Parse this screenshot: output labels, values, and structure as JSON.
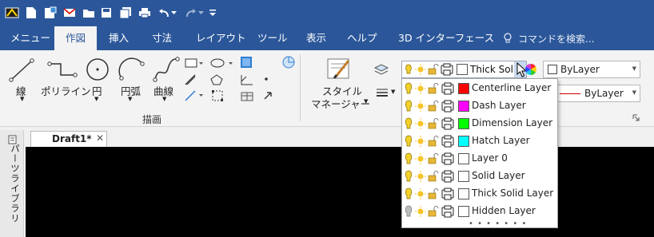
{
  "menu": {
    "items": [
      "メニュー",
      "作図",
      "挿入",
      "寸法",
      "レイアウト",
      "ツール",
      "表示",
      "ヘルプ",
      "3D インターフェース"
    ],
    "active_index": 1,
    "search_placeholder": "コマンドを検索..."
  },
  "ribbon": {
    "tools": {
      "line": "線",
      "polyline": "ポリライン",
      "circle": "円",
      "arc": "円弧",
      "curve": "曲線",
      "style_manager_line1": "スタイル",
      "style_manager_line2": "マネージャー"
    },
    "group_label": "描画",
    "layer_current": "Thick Sol",
    "color_combo": "ByLayer",
    "linetype_combo": "ByLayer"
  },
  "layers": [
    {
      "name": "Centerline Layer",
      "color": "#ff0000",
      "on": true
    },
    {
      "name": "Dash Layer",
      "color": "#ff00ff",
      "on": true
    },
    {
      "name": "Dimension Layer",
      "color": "#00ff00",
      "on": true
    },
    {
      "name": "Hatch Layer",
      "color": "#00ffff",
      "on": true
    },
    {
      "name": "Layer 0",
      "color": "#ffffff",
      "on": true
    },
    {
      "name": "Solid Layer",
      "color": "#ffffff",
      "on": true
    },
    {
      "name": "Thick Solid Layer",
      "color": "#ffffff",
      "on": true
    },
    {
      "name": "Hidden Layer",
      "color": "#ffffff",
      "on": false
    }
  ],
  "document": {
    "tab_title": "Draft1*",
    "side_panel": "パーツライブラリ"
  },
  "colors": {
    "title_bar": "#2b579a",
    "canvas": "#000000"
  }
}
